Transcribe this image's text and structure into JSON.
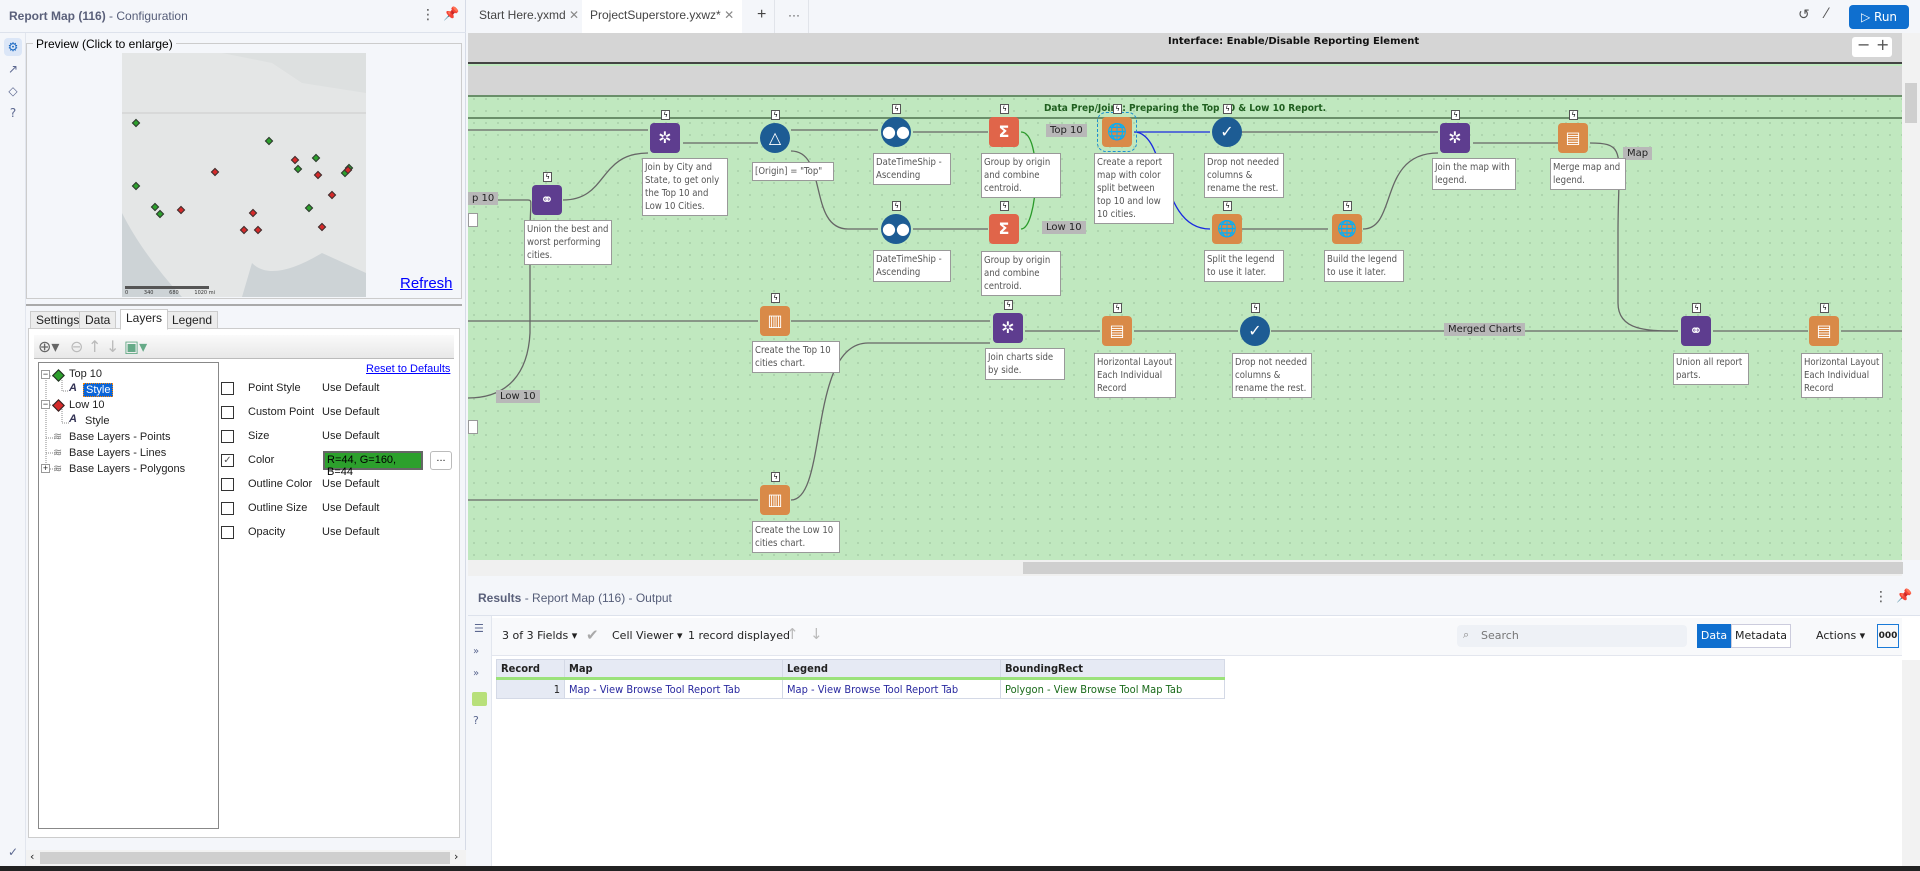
{
  "config_panel": {
    "title": "Report Map (116)",
    "subtitle": "- Configuration",
    "preview_label": "Preview (Click to enlarge)",
    "refresh": "Refresh",
    "map_scale": [
      "0",
      "340",
      "680",
      "1020 mi"
    ],
    "tabs": [
      "Settings",
      "Data",
      "Layers",
      "Legend"
    ],
    "active_tab": "Layers",
    "reset": "Reset to Defaults",
    "tree": [
      {
        "label": "Top 10",
        "color": "#2c9f2c"
      },
      {
        "label": "Style",
        "selected": true
      },
      {
        "label": "Low 10",
        "color": "#d42a2a"
      },
      {
        "label": "Style"
      },
      {
        "label": "Base Layers - Points"
      },
      {
        "label": "Base Layers - Lines"
      },
      {
        "label": "Base Layers - Polygons"
      }
    ],
    "properties": [
      {
        "label": "Point Style",
        "value": "Use Default",
        "checked": false
      },
      {
        "label": "Custom Point",
        "value": "Use Default",
        "checked": false
      },
      {
        "label": "Size",
        "value": "Use Default",
        "checked": false
      },
      {
        "label": "Color",
        "value": "R=44, G=160, B=44",
        "checked": true,
        "swatch": "#2ca02c"
      },
      {
        "label": "Outline Color",
        "value": "Use Default",
        "checked": false
      },
      {
        "label": "Outline Size",
        "value": "Use Default",
        "checked": false
      },
      {
        "label": "Opacity",
        "value": "Use Default",
        "checked": false
      }
    ],
    "color_button": "..."
  },
  "doc_tabs": [
    {
      "label": "Start Here.yxmd"
    },
    {
      "label": "ProjectSuperstore.yxwz*",
      "active": true
    }
  ],
  "run_label": "Run",
  "canvas": {
    "interface_container": "Interface: Enable/Disable Reporting Element",
    "container_title": "Data Prep/Joins: Preparing the Top 10 & Low 10 Report.",
    "nodes": {
      "union1": "Union the best and worst performing cities.",
      "join1": "Join by City and State, to get only the Top 10 and Low 10 Cities.",
      "filter": "[Origin] = \"Top\"",
      "sort1": "DateTimeShip - Ascending",
      "sort2": "DateTimeShip - Ascending",
      "sum1": "Group by origin and combine centroid.",
      "sum2": "Group by origin and combine centroid.",
      "reportmap": "Create a report map with color split between top 10 and low 10 cities.",
      "select1": "Drop not needed columns & rename the rest.",
      "split": "Split the legend to use it later.",
      "build": "Build the legend to use it later.",
      "join2": "Join the map with legend.",
      "merge": "Merge map and legend.",
      "charttop": "Create the Top 10 cities chart.",
      "chartlow": "Create the Low 10 cities chart.",
      "join3": "Join charts side by side.",
      "layout2": "Horizontal Layout Each Individual Record",
      "select2": "Drop not needed columns & rename the rest.",
      "union2": "Union all report parts.",
      "layout3": "Horizontal Layout Each Individual Record"
    },
    "connection_labels": {
      "top10_left": "p 10",
      "low10_left": "Low 10",
      "top10": "Top 10",
      "low10": "Low 10",
      "map": "Map",
      "merged": "Merged Charts"
    }
  },
  "results": {
    "title": "Results",
    "subtitle": "- Report Map (116) - Output",
    "fields": "3 of 3 Fields",
    "viewer": "Cell Viewer",
    "records": "1 record displayed",
    "search_placeholder": "Search",
    "data_btn": "Data",
    "metadata_btn": "Metadata",
    "actions": "Actions",
    "ooo": "000",
    "columns": [
      "Record",
      "Map",
      "Legend",
      "BoundingRect"
    ],
    "rows": [
      [
        "1",
        "Map - View Browse Tool Report Tab",
        "Map - View Browse Tool Report Tab",
        "Polygon - View Browse Tool Map Tab"
      ]
    ]
  }
}
